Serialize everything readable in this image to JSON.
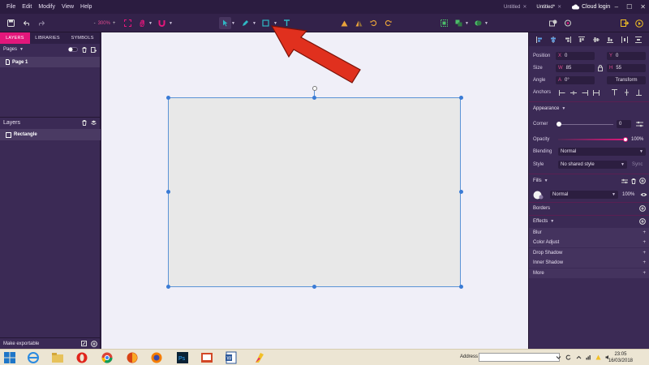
{
  "menu": [
    "File",
    "Edit",
    "Modify",
    "View",
    "Help"
  ],
  "doc_tabs": [
    {
      "label": "Untitled",
      "active": false
    },
    {
      "label": "Untitled*",
      "active": true
    }
  ],
  "cloud_login": "Cloud login",
  "toolbar": {
    "zoom_minus": "-",
    "zoom_value": "300%",
    "zoom_plus": "+"
  },
  "left_panel": {
    "tabs": [
      "LAYERS",
      "LIBRARIES",
      "SYMBOLS"
    ],
    "pages_label": "Pages",
    "page_item": "Page 1",
    "layers_label": "Layers",
    "layer_item": "Rectangle",
    "make_exportable": "Make exportable"
  },
  "right_panel": {
    "position_label": "Position",
    "position_x_axis": "X",
    "position_x": "0",
    "position_y_axis": "Y",
    "position_y": "0",
    "size_label": "Size",
    "size_w_axis": "W",
    "size_w": "85",
    "size_h_axis": "H",
    "size_h": "55",
    "angle_label": "Angle",
    "angle_axis": "A",
    "angle_value": "0°",
    "transform_label": "Transform",
    "anchors_label": "Anchors",
    "appearance_label": "Appearance",
    "corner_label": "Corner",
    "corner_value": "0",
    "opacity_label": "Opacity",
    "opacity_value": "100%",
    "blending_label": "Blending",
    "blending_value": "Normal",
    "style_label": "Style",
    "style_value": "No shared style",
    "sync_label": "Sync",
    "fills_label": "Fills",
    "fill_blend": "Normal",
    "fill_opacity": "100%",
    "borders_label": "Borders",
    "effects_label": "Effects",
    "effects": [
      "Blur",
      "Color Adjust",
      "Drop Shadow",
      "Inner Shadow",
      "More"
    ]
  },
  "taskbar": {
    "address_label": "Address",
    "time": "23:05",
    "date": "16/03/2018"
  },
  "colors": {
    "accent": "#e3177b",
    "panel": "#3b2a55",
    "canvas": "#f0eff8",
    "selection": "#3a7bd5",
    "arrow": "#e0301e"
  }
}
